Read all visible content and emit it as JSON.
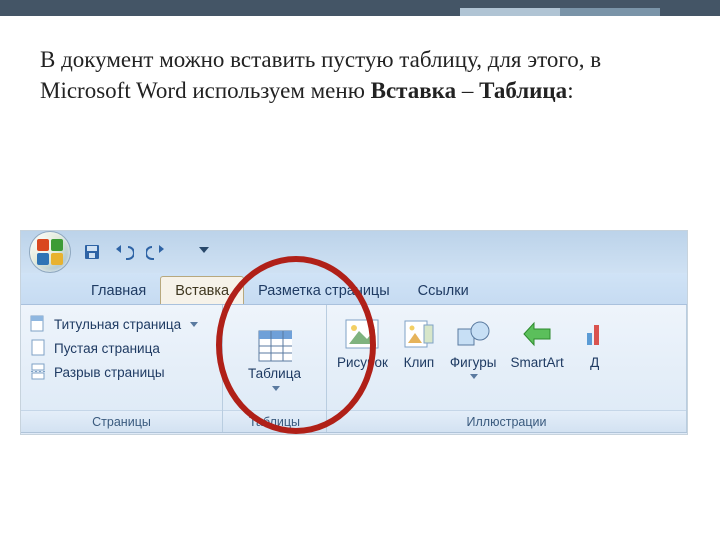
{
  "instruction": {
    "prefix": "В документ можно вставить пустую таблицу, для этого, в Microsoft Word используем меню ",
    "bold1": "Вставка",
    "sep": " – ",
    "bold2": "Таблица",
    "suffix": ":"
  },
  "qat": {
    "save": "Сохранить",
    "undo": "Отменить",
    "redo": "Повторить"
  },
  "tabs": {
    "home": "Главная",
    "insert": "Вставка",
    "layout": "Разметка страницы",
    "refs": "Ссылки"
  },
  "ribbon": {
    "pages": {
      "group": "Страницы",
      "cover": "Титульная страница",
      "blank": "Пустая страница",
      "break": "Разрыв страницы"
    },
    "tables": {
      "group": "Таблицы",
      "table": "Таблица"
    },
    "illus": {
      "group": "Иллюстрации",
      "picture": "Рисунок",
      "clip": "Клип",
      "shapes": "Фигуры",
      "smartart": "SmartArt",
      "chart": "Д"
    }
  }
}
